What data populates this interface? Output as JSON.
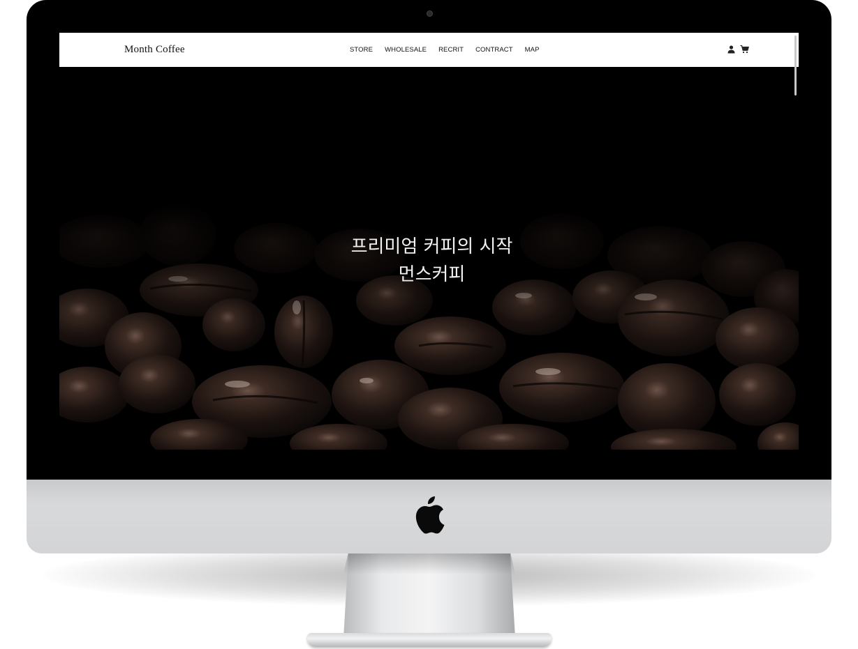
{
  "site": {
    "brand": "Month Coffee",
    "menu": [
      {
        "label": "STORE"
      },
      {
        "label": "WHOLESALE"
      },
      {
        "label": "RECRIT"
      },
      {
        "label": "CONTRACT"
      },
      {
        "label": "MAP"
      }
    ],
    "icons": [
      "user-icon",
      "cart-icon"
    ]
  },
  "hero": {
    "line1": "프리미엄 커피의 시작",
    "line2": "먼스커피"
  },
  "colors": {
    "navbar_bg": "#ffffff",
    "hero_bg": "#000000",
    "text_light": "#f2f2f2",
    "bean_dark": "#1e1410",
    "bean_mid": "#3a2a22"
  }
}
